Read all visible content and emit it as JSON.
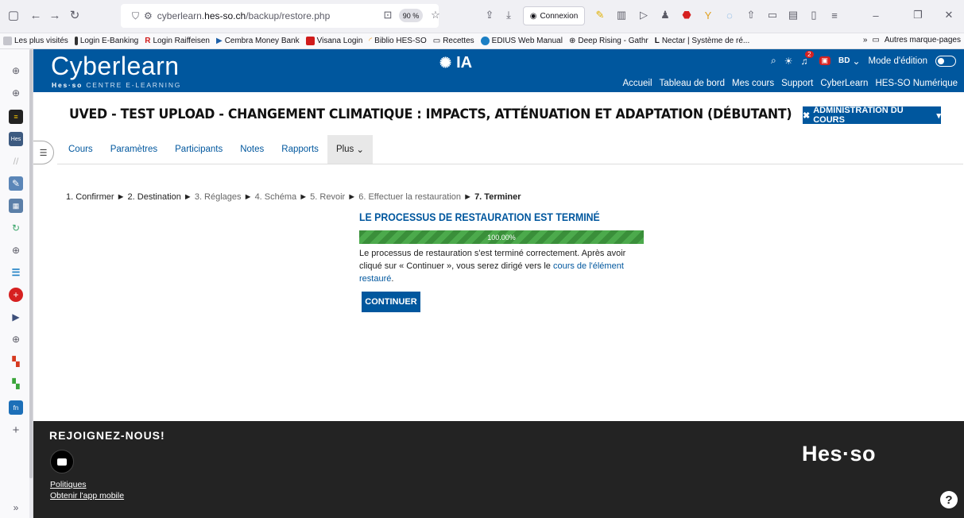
{
  "browser": {
    "url_prefix": "cyberlearn.",
    "url_host": "hes-so.ch",
    "url_path": "/backup/restore.php",
    "zoom": "90 %",
    "connexion_label": "Connexion"
  },
  "bookmarks": {
    "items": [
      {
        "label": "Les plus visités",
        "color": "#5b5b66"
      },
      {
        "label": "Login E-Banking",
        "color": "#333"
      },
      {
        "label": "Login Raiffeisen",
        "color": "#d01b1b"
      },
      {
        "label": "Cembra Money Bank",
        "color": "#1c5fa8"
      },
      {
        "label": "Visana Login",
        "color": "#d01b1b"
      },
      {
        "label": "Biblio HES-SO",
        "color": "#f29a1a"
      },
      {
        "label": "Recettes",
        "color": "#5b5b66"
      },
      {
        "label": "EDIUS Web Manual",
        "color": "#1c7fc4"
      },
      {
        "label": "Deep Rising - Gathr",
        "color": "#5b5b66"
      },
      {
        "label": "Nectar | Système de ré...",
        "color": "#333"
      }
    ],
    "other": "Autres marque-pages"
  },
  "header": {
    "logo": "Cyberlearn",
    "logo_sub_brand": "Hes·so",
    "logo_sub_text": "CENTRE E-LEARNING",
    "ia_label": "IA",
    "notif_count": "2",
    "user_initials": "BD",
    "edit_mode_label": "Mode d'édition",
    "nav": [
      "Accueil",
      "Tableau de bord",
      "Mes cours",
      "Support",
      "CyberLearn",
      "HES-SO Numérique"
    ]
  },
  "course": {
    "title": "UVED - TEST UPLOAD - CHANGEMENT CLIMATIQUE : IMPACTS, ATTÉNUATION ET ADAPTATION (DÉBUTANT)",
    "admin_button": "ADMINISTRATION DU COURS"
  },
  "secondary_nav": {
    "tabs": [
      "Cours",
      "Paramètres",
      "Participants",
      "Notes",
      "Rapports"
    ],
    "more": "Plus"
  },
  "steps": {
    "s1": "1. Confirmer",
    "s2": "2. Destination",
    "s3": "3. Réglages",
    "s4": "4. Schéma",
    "s5": "5. Revoir",
    "s6": "6. Effectuer la restauration",
    "s7": "7. Terminer",
    "sep": "►"
  },
  "result": {
    "title": "LE PROCESSUS DE RESTAURATION EST TERMINÉ",
    "progress_label": "100.00%",
    "progress_value": 100,
    "text": "Le processus de restauration s'est terminé correctement. Après avoir cliqué sur « Continuer », vous serez dirigé vers le ",
    "link": "cours de l'élément restauré",
    "text_end": ".",
    "continue_button": "CONTINUER"
  },
  "footer": {
    "join": "REJOIGNEZ-NOUS!",
    "policies": "Politiques",
    "mobile_app": "Obtenir l'app mobile",
    "logo": "Hes·so",
    "help": "?"
  },
  "colors": {
    "brand": "#00579e",
    "progress": "#3a8f3a",
    "footer_bg": "#232323"
  }
}
